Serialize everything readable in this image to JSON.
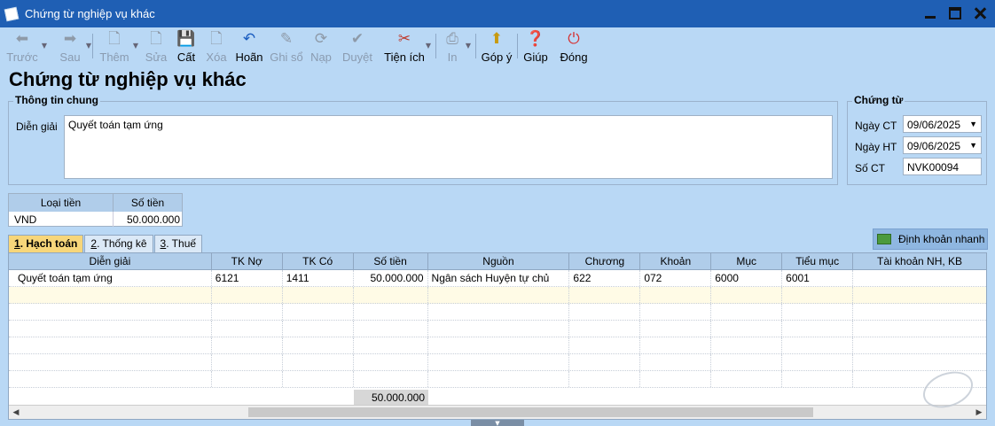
{
  "window": {
    "title": "Chứng từ nghiệp vụ khác"
  },
  "toolbar": {
    "items": [
      {
        "label": "Trước",
        "icon": "arrow-left-icon",
        "enabled": false,
        "dropdown": true
      },
      {
        "label": "Sau",
        "icon": "arrow-right-icon",
        "enabled": false,
        "dropdown": true
      },
      {
        "label": "Thêm",
        "icon": "new-document-icon",
        "enabled": false,
        "dropdown": true
      },
      {
        "label": "Sửa",
        "icon": "edit-document-icon",
        "enabled": false
      },
      {
        "label": "Cất",
        "icon": "save-icon",
        "enabled": true
      },
      {
        "label": "Xóa",
        "icon": "delete-document-icon",
        "enabled": false
      },
      {
        "label": "Hoãn",
        "icon": "undo-icon",
        "enabled": true
      },
      {
        "label": "Ghi sổ",
        "icon": "pen-icon",
        "enabled": false
      },
      {
        "label": "Nạp",
        "icon": "refresh-icon",
        "enabled": false
      },
      {
        "label": "Duyệt",
        "icon": "check-icon",
        "enabled": false
      },
      {
        "label": "Tiện ích",
        "icon": "tools-icon",
        "enabled": true,
        "dropdown": true
      },
      {
        "label": "In",
        "icon": "printer-icon",
        "enabled": false,
        "dropdown": true
      },
      {
        "label": "Góp ý",
        "icon": "feedback-icon",
        "enabled": true
      },
      {
        "label": "Giúp",
        "icon": "help-icon",
        "enabled": true
      },
      {
        "label": "Đóng",
        "icon": "power-icon",
        "enabled": true
      }
    ]
  },
  "page": {
    "title": "Chứng từ nghiệp vụ khác"
  },
  "general_info": {
    "legend": "Thông tin chung",
    "description_label": "Diễn giải",
    "description_value": "Quyết toán tạm ứng"
  },
  "voucher": {
    "legend": "Chứng từ",
    "voucher_date_label": "Ngày CT",
    "voucher_date_value": "09/06/2025",
    "posting_date_label": "Ngày HT",
    "posting_date_value": "09/06/2025",
    "voucher_no_label": "Số CT",
    "voucher_no_value": "NVK00094"
  },
  "currency_table": {
    "headers": [
      "Loại tiền",
      "Số tiền"
    ],
    "row": [
      "VND",
      "50.000.000"
    ]
  },
  "tabs": [
    {
      "key": "1",
      "label": ". Hạch toán",
      "active": true
    },
    {
      "key": "2",
      "label": ". Thống kê",
      "active": false
    },
    {
      "key": "3",
      "label": ". Thuế",
      "active": false
    }
  ],
  "quick_entry_button": {
    "label": "Định khoản nhanh",
    "icon": "quick-entry-icon"
  },
  "grid": {
    "columns": [
      "Diễn giải",
      "TK Nợ",
      "TK Có",
      "Số tiền",
      "Nguồn",
      "Chương",
      "Khoản",
      "Mục",
      "Tiểu mục",
      "Tài khoản NH, KB"
    ],
    "rows": [
      [
        "Quyết toán tạm ứng",
        "6121",
        "1411",
        "50.000.000",
        "Ngân sách Huyện tự chủ",
        "622",
        "072",
        "6000",
        "6001",
        ""
      ]
    ],
    "total": "50.000.000"
  },
  "colors": {
    "titlebar": "#1f5fb4",
    "background": "#b9d8f5",
    "active_tab": "#f7d67a",
    "selected_row": "#fffbe6"
  }
}
